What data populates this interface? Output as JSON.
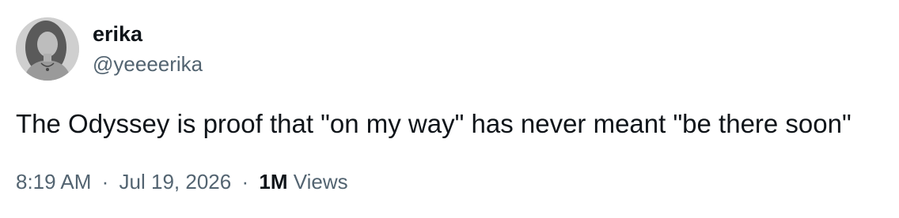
{
  "author": {
    "display_name": "erika",
    "handle": "@yeeeerika",
    "avatar": "profile-photo"
  },
  "tweet": {
    "text": "The Odyssey is proof that \"on my way\" has never meant \"be there soon\""
  },
  "meta": {
    "time": "8:19 AM",
    "separator": "·",
    "date": "Jul 19, 2026",
    "views_count": "1M",
    "views_label": "Views"
  },
  "colors": {
    "text_primary": "#0f1419",
    "text_secondary": "#536471",
    "background": "#ffffff"
  }
}
